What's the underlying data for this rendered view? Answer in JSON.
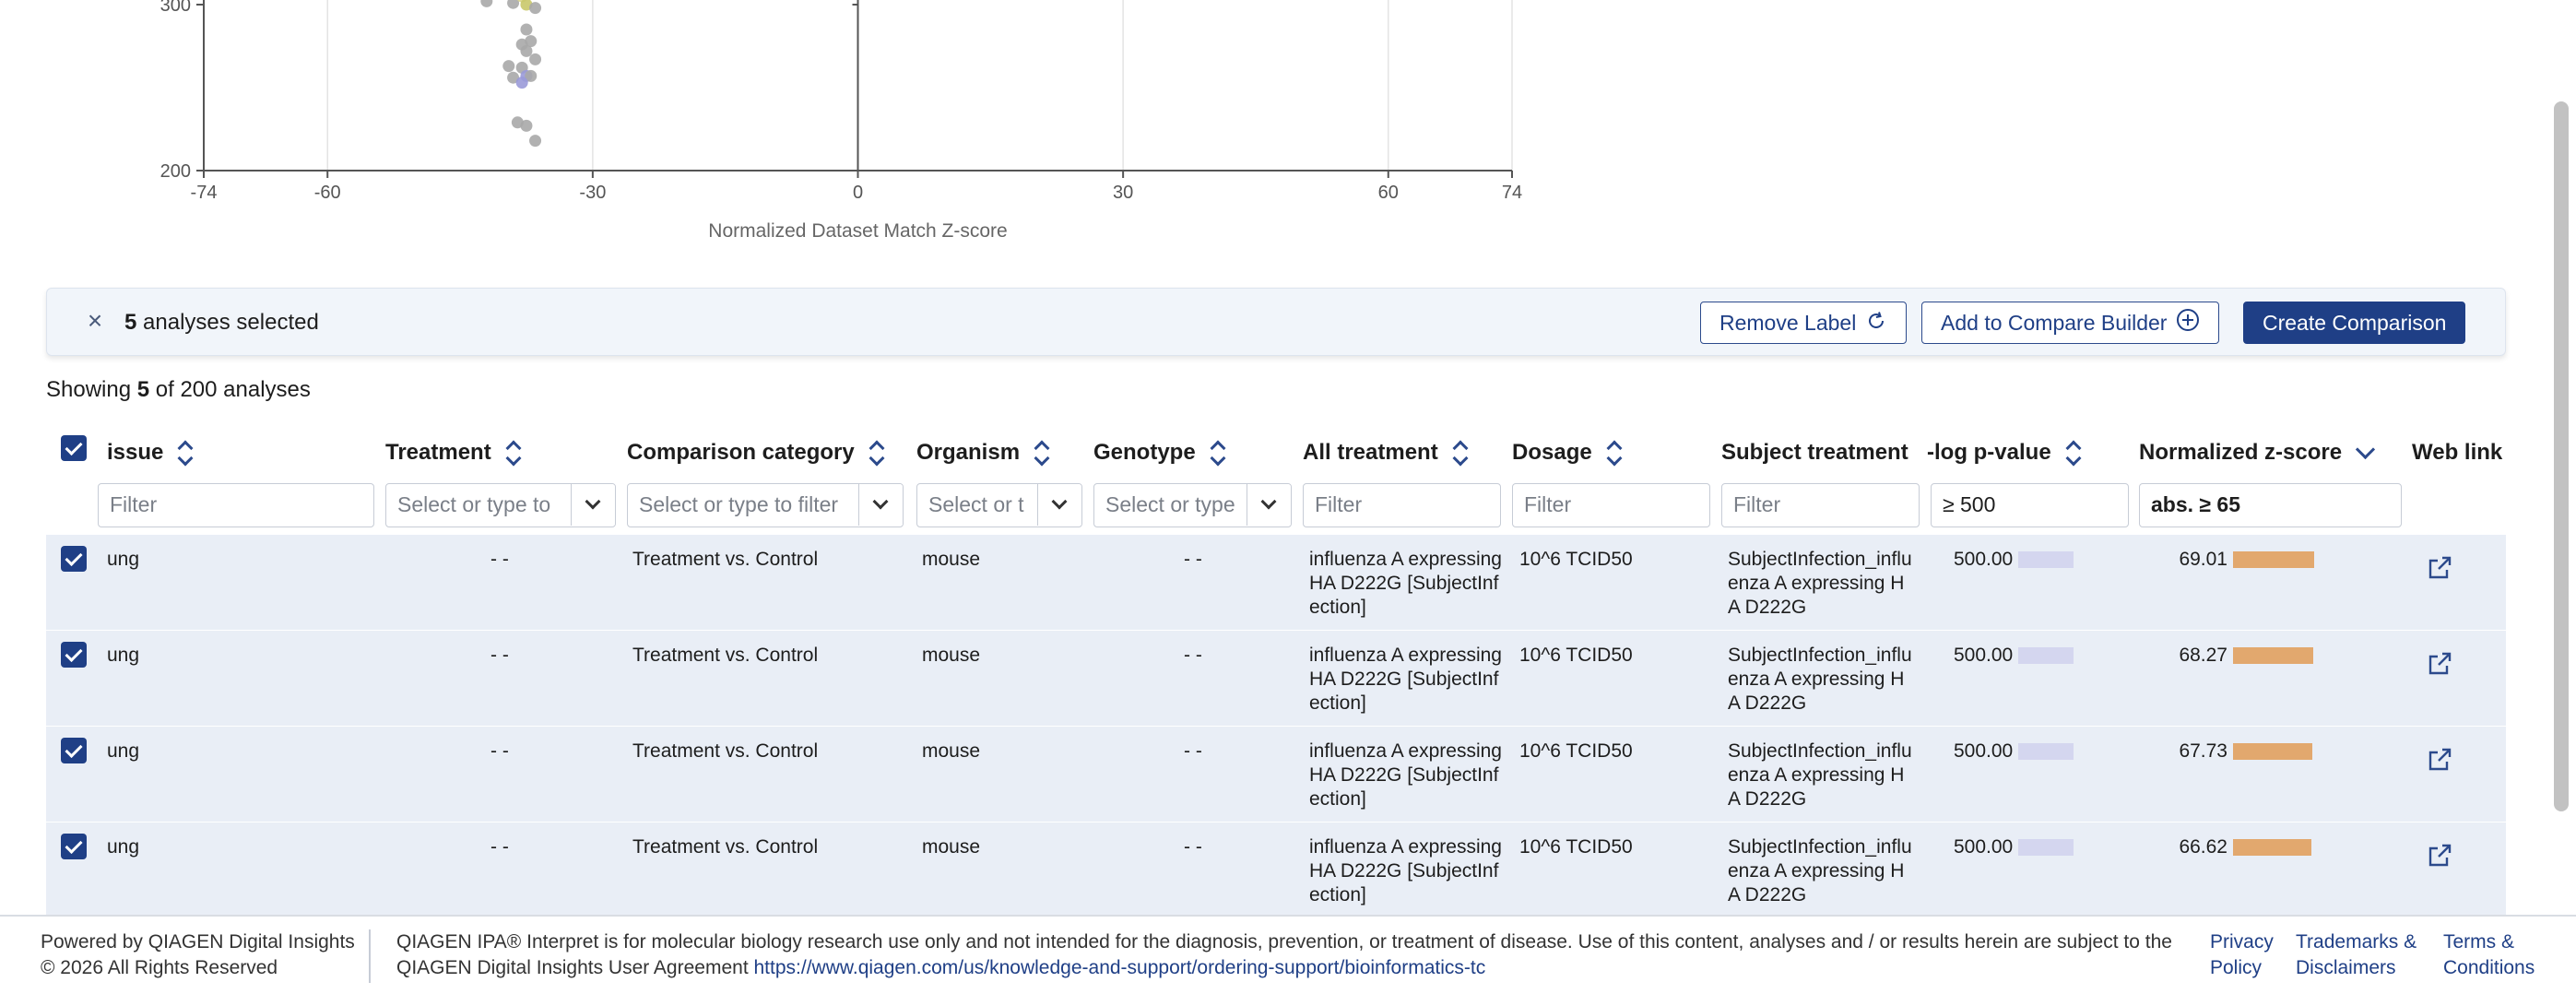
{
  "chart_data": {
    "type": "scatter",
    "xlabel": "Normalized Dataset Match Z-score",
    "ylabel": "",
    "xlim": [
      -74,
      74
    ],
    "x_ticks": [
      "-74",
      "-60",
      "-30",
      "0",
      "30",
      "60",
      "74"
    ],
    "y_ticks": [
      "300",
      "200"
    ],
    "points": [
      {
        "x": -42,
        "y": 302,
        "color": "#a8a8a8"
      },
      {
        "x": -39,
        "y": 301,
        "color": "#a8a8a8"
      },
      {
        "x": -38,
        "y": 305,
        "color": "#d8d48c"
      },
      {
        "x": -37.5,
        "y": 300,
        "color": "#c9c86a"
      },
      {
        "x": -36.5,
        "y": 298,
        "color": "#a8a8a8"
      },
      {
        "x": -37.5,
        "y": 285,
        "color": "#a8a8a8"
      },
      {
        "x": -38,
        "y": 276,
        "color": "#a8a8a8"
      },
      {
        "x": -37,
        "y": 278,
        "color": "#a8a8a8"
      },
      {
        "x": -37.5,
        "y": 272,
        "color": "#a8a8a8"
      },
      {
        "x": -39.5,
        "y": 263,
        "color": "#a8a8a8"
      },
      {
        "x": -36.5,
        "y": 267,
        "color": "#a8a8a8"
      },
      {
        "x": -38,
        "y": 262,
        "color": "#a8a8a8"
      },
      {
        "x": -37.5,
        "y": 257,
        "color": "#9a9ad8"
      },
      {
        "x": -39,
        "y": 256,
        "color": "#a8a8a8"
      },
      {
        "x": -37,
        "y": 257,
        "color": "#a8a8a8"
      },
      {
        "x": -38,
        "y": 253,
        "color": "#9a9ad8"
      },
      {
        "x": -38.5,
        "y": 229,
        "color": "#a8a8a8"
      },
      {
        "x": -37.5,
        "y": 227,
        "color": "#a8a8a8"
      },
      {
        "x": -36.5,
        "y": 218,
        "color": "#a8a8a8"
      }
    ]
  },
  "selection": {
    "count": "5",
    "suffix": " analyses selected",
    "buttons": {
      "remove_label": "Remove Label",
      "add_compare": "Add to Compare Builder",
      "create": "Create Comparison"
    }
  },
  "showing": {
    "prefix": "Showing ",
    "count": "5",
    "suffix": " of 200 analyses"
  },
  "table": {
    "headers": {
      "tissue": "issue",
      "treatment": "Treatment",
      "comparison": "Comparison category",
      "organism": "Organism",
      "genotype": "Genotype",
      "all_treatment": "All treatment",
      "dosage": "Dosage",
      "subject_treatment": "Subject treatment",
      "pvalue": "-log p-value",
      "zscore": "Normalized z-score",
      "weblink": "Web link"
    },
    "filters": {
      "tissue": "Filter",
      "treatment": "Select or type to",
      "comparison": "Select or type to filter",
      "organism": "Select or t",
      "genotype": "Select or type",
      "all_treatment": "Filter",
      "dosage": "Filter",
      "subject_treatment": "Filter",
      "pvalue": "≥ 500",
      "zscore": "abs. ≥ 65"
    },
    "rows": [
      {
        "tissue": "ung",
        "treatment": "- -",
        "comparison": "Treatment vs. Control",
        "organism": "mouse",
        "genotype": "- -",
        "all_treatment": "influenza A expressing HA D222G [SubjectInfection]",
        "dosage": "10^6 TCID50",
        "subject_treatment": "SubjectInfection_influenza A expressing HA D222G",
        "pvalue": "500.00",
        "zscore": "69.01",
        "zfrac": 1.0
      },
      {
        "tissue": "ung",
        "treatment": "- -",
        "comparison": "Treatment vs. Control",
        "organism": "mouse",
        "genotype": "- -",
        "all_treatment": "influenza A expressing HA D222G [SubjectInfection]",
        "dosage": "10^6 TCID50",
        "subject_treatment": "SubjectInfection_influenza A expressing HA D222G",
        "pvalue": "500.00",
        "zscore": "68.27",
        "zfrac": 0.99
      },
      {
        "tissue": "ung",
        "treatment": "- -",
        "comparison": "Treatment vs. Control",
        "organism": "mouse",
        "genotype": "- -",
        "all_treatment": "influenza A expressing HA D222G [SubjectInfection]",
        "dosage": "10^6 TCID50",
        "subject_treatment": "SubjectInfection_influenza A expressing HA D222G",
        "pvalue": "500.00",
        "zscore": "67.73",
        "zfrac": 0.98
      },
      {
        "tissue": "ung",
        "treatment": "- -",
        "comparison": "Treatment vs. Control",
        "organism": "mouse",
        "genotype": "- -",
        "all_treatment": "influenza A expressing HA D222G [SubjectInfection]",
        "dosage": "10^6 TCID50",
        "subject_treatment": "SubjectInfection_influenza A expressing HA D222G",
        "pvalue": "500.00",
        "zscore": "66.62",
        "zfrac": 0.965
      }
    ]
  },
  "footer": {
    "powered": "Powered by QIAGEN Digital Insights",
    "copyright": "© 2026 All Rights Reserved",
    "disclaimer_line1": "QIAGEN IPA® Interpret is for molecular biology research use only and not intended for the diagnosis, prevention, or treatment of disease. Use of this content, analyses and / or results herein are subject to the",
    "disclaimer_line2": "QIAGEN Digital Insights User Agreement ",
    "agreement_url": "https://www.qiagen.com/us/knowledge-and-support/ordering-support/bioinformatics-tc",
    "privacy": "Privacy Policy",
    "trademarks": "Trademarks & Disclaimers",
    "terms": "Terms & Conditions"
  },
  "colors": {
    "accent": "#1f3f86",
    "pbar": "#d4d6ef",
    "zbar": "#e2a86e",
    "row_bg": "#e9eef6"
  }
}
